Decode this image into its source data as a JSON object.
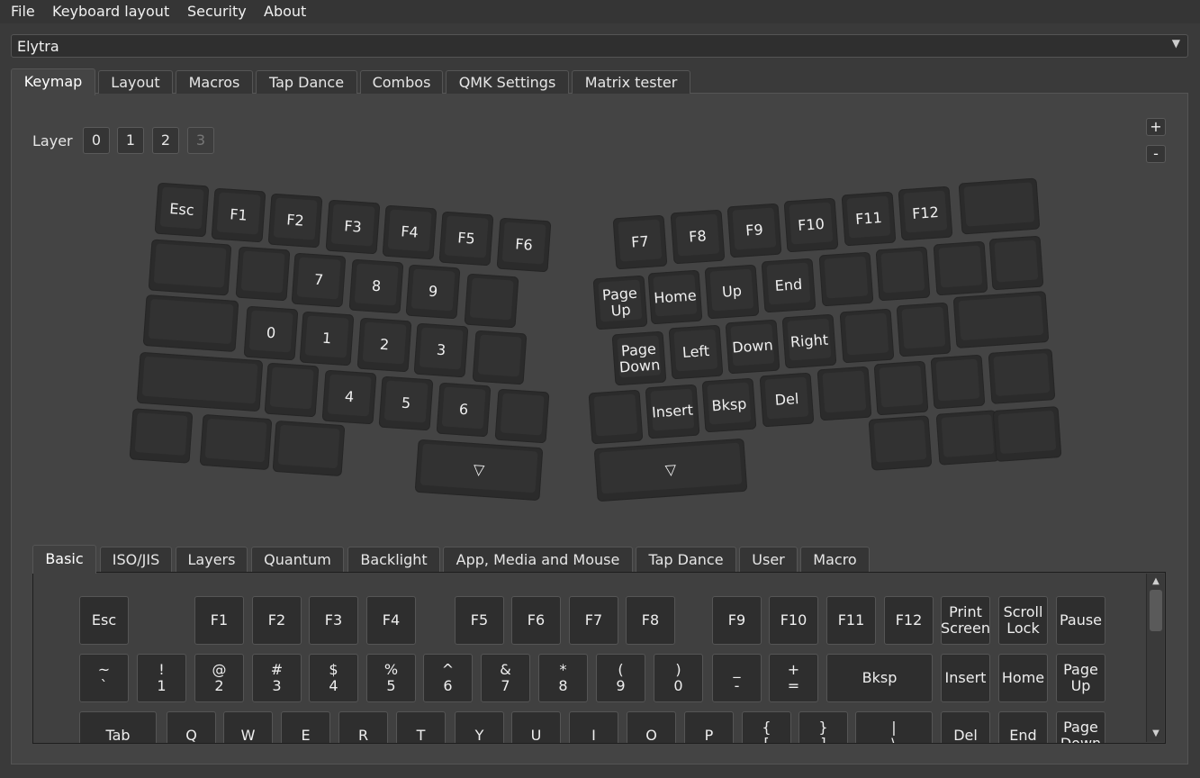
{
  "menu": {
    "file": "File",
    "keyboard_layout": "Keyboard layout",
    "security": "Security",
    "about": "About"
  },
  "keyboard_select": {
    "value": "Elytra",
    "arrow": "▼"
  },
  "main_tabs": [
    {
      "label": "Keymap"
    },
    {
      "label": "Layout"
    },
    {
      "label": "Macros"
    },
    {
      "label": "Tap Dance"
    },
    {
      "label": "Combos"
    },
    {
      "label": "QMK Settings"
    },
    {
      "label": "Matrix tester"
    }
  ],
  "layers": {
    "label": "Layer",
    "buttons": [
      "0",
      "1",
      "2",
      "3"
    ]
  },
  "zoom": {
    "plus": "+",
    "minus": "-"
  },
  "split_keys": [
    {
      "t": "Esc"
    },
    {
      "t": "F1"
    },
    {
      "t": "F2"
    },
    {
      "t": "F3"
    },
    {
      "t": "F4"
    },
    {
      "t": "F5"
    },
    {
      "t": "F6"
    },
    {
      "t": ""
    },
    {
      "t": ""
    },
    {
      "t": "7"
    },
    {
      "t": "8"
    },
    {
      "t": "9"
    },
    {
      "t": ""
    },
    {
      "t": ""
    },
    {
      "t": "0"
    },
    {
      "t": "1"
    },
    {
      "t": "2"
    },
    {
      "t": "3"
    },
    {
      "t": ""
    },
    {
      "t": ""
    },
    {
      "t": ""
    },
    {
      "t": "4"
    },
    {
      "t": "5"
    },
    {
      "t": "6"
    },
    {
      "t": ""
    },
    {
      "t": ""
    },
    {
      "t": ""
    },
    {
      "t": ""
    },
    {
      "t": "▽"
    },
    {
      "t": "F7"
    },
    {
      "t": "F8"
    },
    {
      "t": "F9"
    },
    {
      "t": "F10"
    },
    {
      "t": "F11"
    },
    {
      "t": "F12"
    },
    {
      "t": ""
    },
    {
      "t": "Page Up"
    },
    {
      "t": "Home"
    },
    {
      "t": "Up"
    },
    {
      "t": "End"
    },
    {
      "t": ""
    },
    {
      "t": ""
    },
    {
      "t": ""
    },
    {
      "t": ""
    },
    {
      "t": "Page Down"
    },
    {
      "t": "Left"
    },
    {
      "t": "Down"
    },
    {
      "t": "Right"
    },
    {
      "t": ""
    },
    {
      "t": ""
    },
    {
      "t": ""
    },
    {
      "t": ""
    },
    {
      "t": "Insert"
    },
    {
      "t": "Bksp"
    },
    {
      "t": "Del"
    },
    {
      "t": ""
    },
    {
      "t": ""
    },
    {
      "t": ""
    },
    {
      "t": ""
    },
    {
      "t": "▽"
    },
    {
      "t": ""
    },
    {
      "t": ""
    },
    {
      "t": ""
    }
  ],
  "sub_tabs": [
    {
      "label": "Basic"
    },
    {
      "label": "ISO/JIS"
    },
    {
      "label": "Layers"
    },
    {
      "label": "Quantum"
    },
    {
      "label": "Backlight"
    },
    {
      "label": "App, Media and Mouse"
    },
    {
      "label": "Tap Dance"
    },
    {
      "label": "User"
    },
    {
      "label": "Macro"
    }
  ],
  "palette_keys": [
    {
      "t": "Esc",
      "b": ""
    },
    {
      "t": "F1",
      "b": ""
    },
    {
      "t": "F2",
      "b": ""
    },
    {
      "t": "F3",
      "b": ""
    },
    {
      "t": "F4",
      "b": ""
    },
    {
      "t": "F5",
      "b": ""
    },
    {
      "t": "F6",
      "b": ""
    },
    {
      "t": "F7",
      "b": ""
    },
    {
      "t": "F8",
      "b": ""
    },
    {
      "t": "F9",
      "b": ""
    },
    {
      "t": "F10",
      "b": ""
    },
    {
      "t": "F11",
      "b": ""
    },
    {
      "t": "F12",
      "b": ""
    },
    {
      "t": "Print",
      "b": "Screen"
    },
    {
      "t": "Scroll",
      "b": "Lock"
    },
    {
      "t": "Pause",
      "b": ""
    },
    {
      "t": "~",
      "b": "`"
    },
    {
      "t": "!",
      "b": "1"
    },
    {
      "t": "@",
      "b": "2"
    },
    {
      "t": "#",
      "b": "3"
    },
    {
      "t": "$",
      "b": "4"
    },
    {
      "t": "%",
      "b": "5"
    },
    {
      "t": "^",
      "b": "6"
    },
    {
      "t": "&",
      "b": "7"
    },
    {
      "t": "*",
      "b": "8"
    },
    {
      "t": "(",
      "b": "9"
    },
    {
      "t": ")",
      "b": "0"
    },
    {
      "t": "_",
      "b": "-"
    },
    {
      "t": "+",
      "b": "="
    },
    {
      "t": "Bksp",
      "b": ""
    },
    {
      "t": "Insert",
      "b": ""
    },
    {
      "t": "Home",
      "b": ""
    },
    {
      "t": "Page",
      "b": "Up"
    },
    {
      "t": "Tab",
      "b": ""
    },
    {
      "t": "Q",
      "b": ""
    },
    {
      "t": "W",
      "b": ""
    },
    {
      "t": "E",
      "b": ""
    },
    {
      "t": "R",
      "b": ""
    },
    {
      "t": "T",
      "b": ""
    },
    {
      "t": "Y",
      "b": ""
    },
    {
      "t": "U",
      "b": ""
    },
    {
      "t": "I",
      "b": ""
    },
    {
      "t": "O",
      "b": ""
    },
    {
      "t": "P",
      "b": ""
    },
    {
      "t": "{",
      "b": "["
    },
    {
      "t": "}",
      "b": "]"
    },
    {
      "t": "|",
      "b": "\\"
    },
    {
      "t": "Del",
      "b": ""
    },
    {
      "t": "End",
      "b": ""
    },
    {
      "t": "Page",
      "b": "Down"
    }
  ],
  "scroll": {
    "up": "▲",
    "down": "▼"
  }
}
